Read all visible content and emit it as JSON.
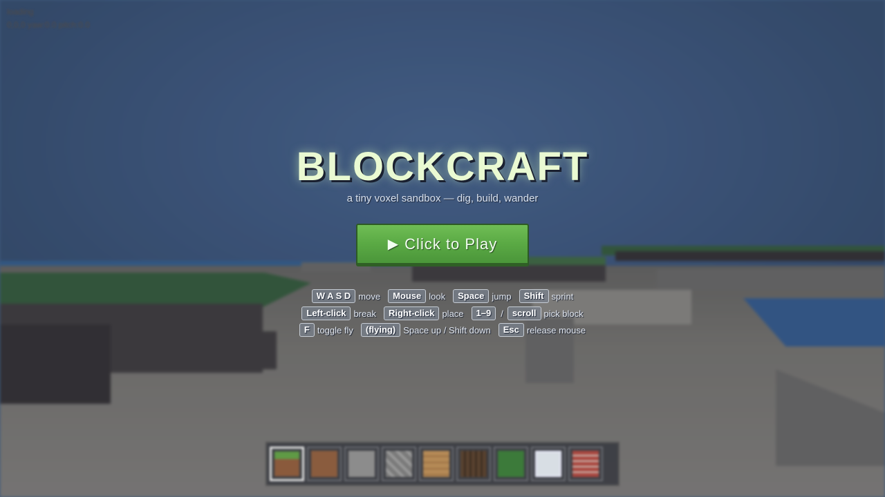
{
  "debug": {
    "line1": "loading",
    "line2": "0,0,0 yaw:0.0 pitch:0.0"
  },
  "menu": {
    "title": "BLOCKCRAFT",
    "subtitle": "a tiny voxel sandbox — dig, build, wander",
    "play_icon": "▶",
    "play_label": "Click to Play"
  },
  "controls": {
    "row1": [
      {
        "key": "W A S D",
        "action": "move"
      },
      {
        "key": "Mouse",
        "action": "look"
      },
      {
        "key": "Space",
        "action": "jump"
      },
      {
        "key": "Shift",
        "action": "sprint"
      }
    ],
    "row2": {
      "left_click": {
        "key": "Left-click",
        "action": "break"
      },
      "right_click": {
        "key": "Right-click",
        "action": "place"
      },
      "numbers_key": "1–9",
      "separator": "/",
      "scroll_key": "scroll",
      "pick_action": "pick block"
    },
    "row3": [
      {
        "key": "F",
        "action": "toggle fly"
      },
      {
        "key": "(flying)",
        "action": "Space up / Shift down"
      },
      {
        "key": "Esc",
        "action": "release mouse"
      }
    ]
  },
  "hotbar": {
    "selected_slot": 1,
    "slots": [
      "grass",
      "dirt",
      "stone",
      "cobblestone",
      "planks",
      "log",
      "leaves",
      "glass",
      "brick"
    ]
  },
  "icons": {
    "play": "play-icon"
  }
}
